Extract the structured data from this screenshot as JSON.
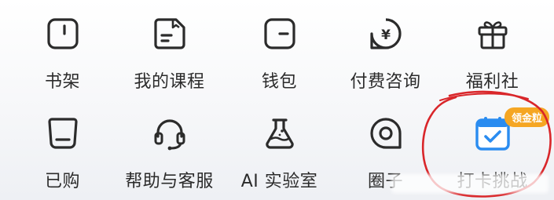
{
  "menu": {
    "row1": [
      {
        "label": "书架",
        "icon": "bookshelf-icon"
      },
      {
        "label": "我的课程",
        "icon": "course-icon"
      },
      {
        "label": "钱包",
        "icon": "wallet-icon"
      },
      {
        "label": "付费咨询",
        "icon": "paid-consult-icon"
      },
      {
        "label": "福利社",
        "icon": "gift-icon"
      }
    ],
    "row2": [
      {
        "label": "已购",
        "icon": "purchased-icon"
      },
      {
        "label": "帮助与客服",
        "icon": "headset-icon"
      },
      {
        "label": "AI 实验室",
        "icon": "flask-icon"
      },
      {
        "label": "圈子",
        "icon": "circle-group-icon"
      },
      {
        "label": "打卡挑战",
        "icon": "calendar-check-icon"
      }
    ]
  },
  "badge": {
    "text": "领金粒",
    "color": "#f5a623"
  },
  "colors": {
    "icon_stroke": "#2b2b2b",
    "accent_blue": "#2a8cf0",
    "annotation_red": "#d9262a"
  },
  "symbols": {
    "yen": "¥"
  }
}
